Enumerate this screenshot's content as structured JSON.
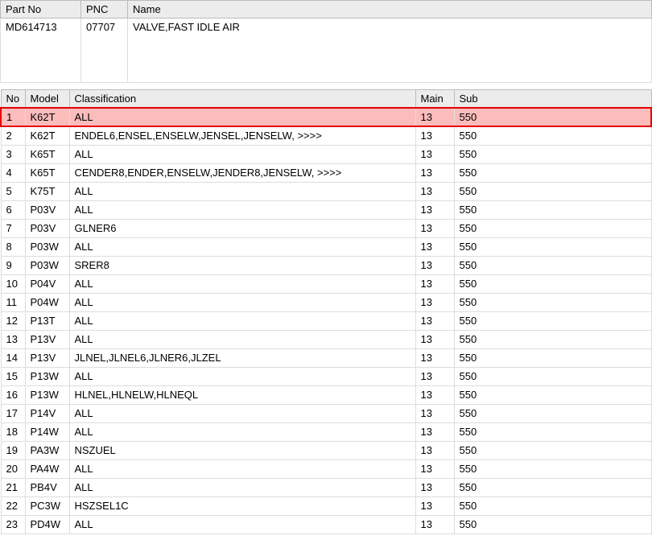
{
  "header": {
    "columns": {
      "partno": "Part No",
      "pnc": "PNC",
      "name": "Name"
    },
    "values": {
      "partno": "MD614713",
      "pnc": "07707",
      "name": "VALVE,FAST IDLE AIR"
    }
  },
  "table": {
    "columns": {
      "no": "No",
      "model": "Model",
      "classification": "Classification",
      "main": "Main",
      "sub": "Sub"
    },
    "rows": [
      {
        "no": "1",
        "model": "K62T",
        "classification": "ALL",
        "main": "13",
        "sub": "550",
        "highlight": true
      },
      {
        "no": "2",
        "model": "K62T",
        "classification": "ENDEL6,ENSEL,ENSELW,JENSEL,JENSELW,  >>>>",
        "main": "13",
        "sub": "550"
      },
      {
        "no": "3",
        "model": "K65T",
        "classification": "ALL",
        "main": "13",
        "sub": "550"
      },
      {
        "no": "4",
        "model": "K65T",
        "classification": "CENDER8,ENDER,ENSELW,JENDER8,JENSELW,  >>>>",
        "main": "13",
        "sub": "550"
      },
      {
        "no": "5",
        "model": "K75T",
        "classification": "ALL",
        "main": "13",
        "sub": "550"
      },
      {
        "no": "6",
        "model": "P03V",
        "classification": "ALL",
        "main": "13",
        "sub": "550"
      },
      {
        "no": "7",
        "model": "P03V",
        "classification": "GLNER6",
        "main": "13",
        "sub": "550"
      },
      {
        "no": "8",
        "model": "P03W",
        "classification": "ALL",
        "main": "13",
        "sub": "550"
      },
      {
        "no": "9",
        "model": "P03W",
        "classification": "SRER8",
        "main": "13",
        "sub": "550"
      },
      {
        "no": "10",
        "model": "P04V",
        "classification": "ALL",
        "main": "13",
        "sub": "550"
      },
      {
        "no": "11",
        "model": "P04W",
        "classification": "ALL",
        "main": "13",
        "sub": "550"
      },
      {
        "no": "12",
        "model": "P13T",
        "classification": "ALL",
        "main": "13",
        "sub": "550"
      },
      {
        "no": "13",
        "model": "P13V",
        "classification": "ALL",
        "main": "13",
        "sub": "550"
      },
      {
        "no": "14",
        "model": "P13V",
        "classification": "JLNEL,JLNEL6,JLNER6,JLZEL",
        "main": "13",
        "sub": "550"
      },
      {
        "no": "15",
        "model": "P13W",
        "classification": "ALL",
        "main": "13",
        "sub": "550"
      },
      {
        "no": "16",
        "model": "P13W",
        "classification": "HLNEL,HLNELW,HLNEQL",
        "main": "13",
        "sub": "550"
      },
      {
        "no": "17",
        "model": "P14V",
        "classification": "ALL",
        "main": "13",
        "sub": "550"
      },
      {
        "no": "18",
        "model": "P14W",
        "classification": "ALL",
        "main": "13",
        "sub": "550"
      },
      {
        "no": "19",
        "model": "PA3W",
        "classification": "NSZUEL",
        "main": "13",
        "sub": "550"
      },
      {
        "no": "20",
        "model": "PA4W",
        "classification": "ALL",
        "main": "13",
        "sub": "550"
      },
      {
        "no": "21",
        "model": "PB4V",
        "classification": "ALL",
        "main": "13",
        "sub": "550"
      },
      {
        "no": "22",
        "model": "PC3W",
        "classification": "HSZSEL1C",
        "main": "13",
        "sub": "550"
      },
      {
        "no": "23",
        "model": "PD4W",
        "classification": "ALL",
        "main": "13",
        "sub": "550"
      }
    ]
  }
}
